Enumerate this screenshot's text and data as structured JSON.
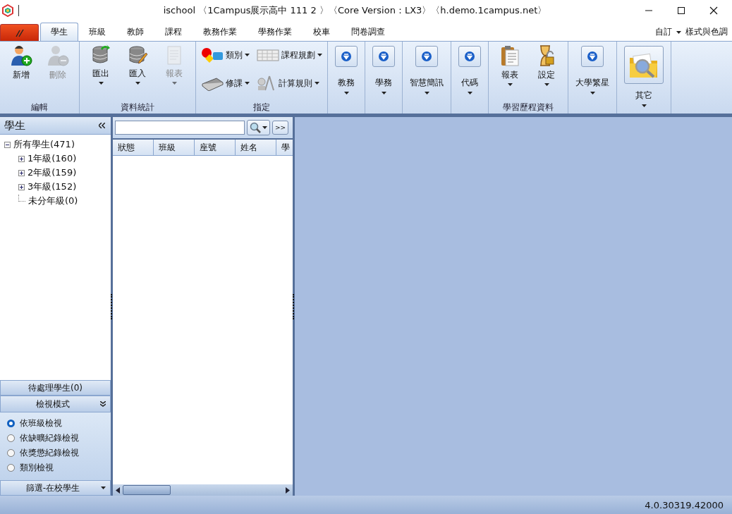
{
  "window": {
    "title": "ischool 〈1Campus展示高中 111 2 〉〈Core Version：LX3〉〈h.demo.1campus.net〉"
  },
  "ribbon_tabs": [
    {
      "label": "學生",
      "selected": true
    },
    {
      "label": "班級",
      "selected": false
    },
    {
      "label": "教師",
      "selected": false
    },
    {
      "label": "課程",
      "selected": false
    },
    {
      "label": "教務作業",
      "selected": false
    },
    {
      "label": "學務作業",
      "selected": false
    },
    {
      "label": "校車",
      "selected": false
    },
    {
      "label": "問卷調查",
      "selected": false
    }
  ],
  "ribbon_right": {
    "customize": "自訂",
    "style": "樣式與色調"
  },
  "ribbon_groups": [
    {
      "label": "編輯",
      "items": [
        {
          "kind": "large",
          "label": "新增",
          "disabled": false,
          "dropdown": false
        },
        {
          "kind": "large",
          "label": "刪除",
          "disabled": true,
          "dropdown": false
        }
      ]
    },
    {
      "label": "資料統計",
      "items": [
        {
          "kind": "large",
          "label": "匯出",
          "disabled": false,
          "dropdown": true
        },
        {
          "kind": "large",
          "label": "匯入",
          "disabled": false,
          "dropdown": true
        },
        {
          "kind": "large",
          "label": "報表",
          "disabled": true,
          "dropdown": true
        }
      ]
    },
    {
      "label": "指定",
      "items": [
        {
          "kind": "small",
          "label": "類別",
          "disabled": false,
          "dropdown": true
        },
        {
          "kind": "small",
          "label": "修課",
          "disabled": false,
          "dropdown": true
        },
        {
          "kind": "small",
          "label": "課程規劃",
          "disabled": false,
          "dropdown": true
        },
        {
          "kind": "small",
          "label": "計算規則",
          "disabled": false,
          "dropdown": true
        }
      ]
    },
    {
      "items": [
        {
          "kind": "button",
          "label": "教務",
          "disabled": false,
          "dropdown": true
        }
      ]
    },
    {
      "items": [
        {
          "kind": "button",
          "label": "學務",
          "disabled": false,
          "dropdown": true
        }
      ]
    },
    {
      "items": [
        {
          "kind": "button",
          "label": "智慧簡訊",
          "disabled": false,
          "dropdown": true
        }
      ]
    },
    {
      "items": [
        {
          "kind": "button",
          "label": "代碼",
          "disabled": false,
          "dropdown": true
        }
      ]
    },
    {
      "label": "學習歷程資料",
      "items": [
        {
          "kind": "large",
          "label": "報表",
          "disabled": false,
          "dropdown": true
        },
        {
          "kind": "large",
          "label": "設定",
          "disabled": false,
          "dropdown": true
        }
      ]
    },
    {
      "items": [
        {
          "kind": "button",
          "label": "大學繁星",
          "disabled": false,
          "dropdown": true
        }
      ]
    },
    {
      "items": [
        {
          "kind": "bigbutton",
          "label": "其它",
          "disabled": false,
          "dropdown": true
        }
      ]
    }
  ],
  "sidebar": {
    "title": "學生",
    "tree": [
      {
        "label": "所有學生(471)",
        "expanded": true,
        "children": [
          {
            "label": "1年級(160)",
            "expanded": false
          },
          {
            "label": "2年級(159)",
            "expanded": false
          },
          {
            "label": "3年級(152)",
            "expanded": false
          },
          {
            "label": "未分年級(0)"
          }
        ]
      }
    ],
    "pending": "待處理學生(0)",
    "view_mode": {
      "title": "檢視模式",
      "options": [
        {
          "label": "依班級檢視",
          "selected": true
        },
        {
          "label": "依缺曠紀錄檢視",
          "selected": false
        },
        {
          "label": "依獎懲紀錄檢視",
          "selected": false
        },
        {
          "label": "類別檢視",
          "selected": false
        }
      ]
    },
    "filter": "篩選-在校學生"
  },
  "student_list": {
    "more_button": ">>",
    "columns": [
      "狀態",
      "班級",
      "座號",
      "姓名",
      "學"
    ]
  },
  "status_bar": {
    "version": "4.0.30319.42000"
  }
}
